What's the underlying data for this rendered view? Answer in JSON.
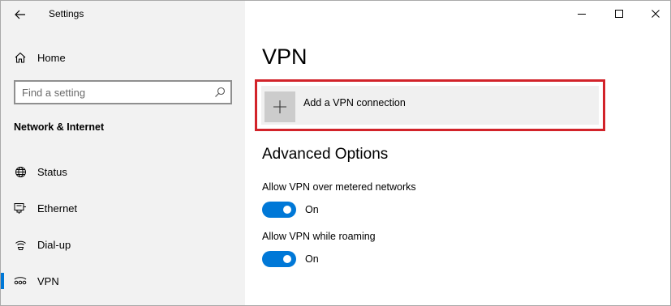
{
  "window": {
    "title": "Settings"
  },
  "sidebar": {
    "home_label": "Home",
    "search_placeholder": "Find a setting",
    "section_heading": "Network & Internet",
    "items": [
      {
        "label": "Status",
        "icon": "globe-icon",
        "active": false
      },
      {
        "label": "Ethernet",
        "icon": "ethernet-icon",
        "active": false
      },
      {
        "label": "Dial-up",
        "icon": "dial-up-icon",
        "active": false
      },
      {
        "label": "VPN",
        "icon": "vpn-icon",
        "active": true
      }
    ]
  },
  "main": {
    "title": "VPN",
    "add_connection_label": "Add a VPN connection",
    "advanced_heading": "Advanced Options",
    "settings": [
      {
        "label": "Allow VPN over metered networks",
        "state": "On",
        "enabled": true
      },
      {
        "label": "Allow VPN while roaming",
        "state": "On",
        "enabled": true
      }
    ]
  },
  "colors": {
    "accent": "#0078d7",
    "highlight_border": "#d2232a",
    "sidebar_bg": "#f2f2f2"
  }
}
